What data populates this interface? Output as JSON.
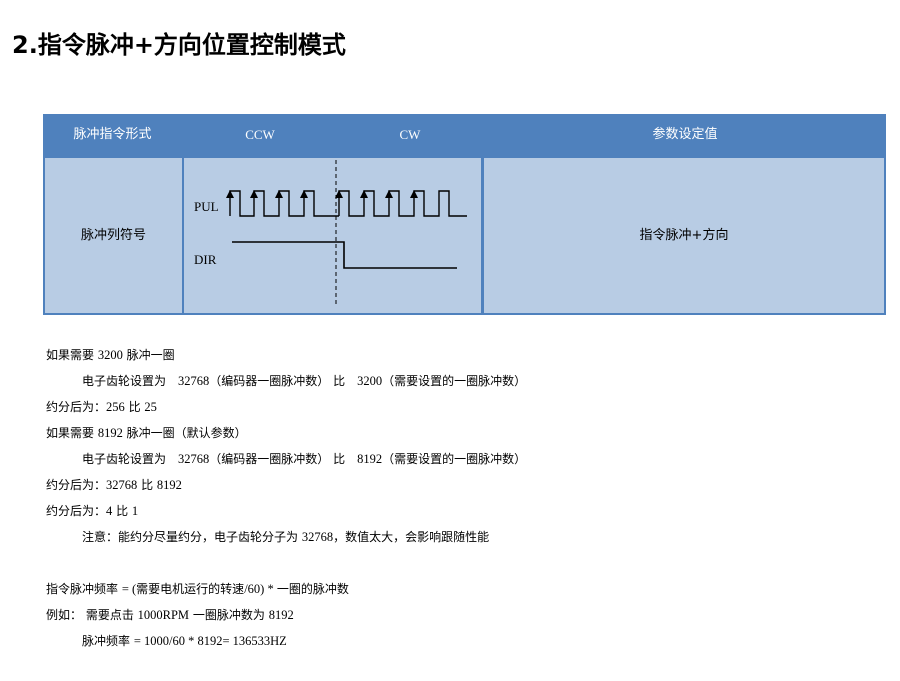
{
  "title": "2.指令脉冲+方向位置控制模式",
  "table": {
    "headers": {
      "format": "脉冲指令形式",
      "ccw": "CCW",
      "cw": "CW",
      "setting": "参数设定值"
    },
    "row": {
      "label": "脉冲列符号",
      "pul_label": "PUL",
      "dir_label": "DIR",
      "setting_value": "指令脉冲+方向"
    }
  },
  "notes": {
    "l1_a": "如果需要 ",
    "l1_n": "3200",
    "l1_b": " 脉冲一圈",
    "l2_a": "电子齿轮设置为　",
    "l2_n1": "32768",
    "l2_b": "（编码器一圈脉冲数）  比　",
    "l2_n2": "3200",
    "l2_c": "（需要设置的一圈脉冲数）",
    "l3_a": "约分后为：",
    "l3_n1": "256",
    "l3_b": " 比 ",
    "l3_n2": "25",
    "l4_a": "如果需要 ",
    "l4_n": "8192",
    "l4_b": " 脉冲一圈（默认参数）",
    "l5_a": "电子齿轮设置为　",
    "l5_n1": "32768",
    "l5_b": "（编码器一圈脉冲数）  比　",
    "l5_n2": "8192",
    "l5_c": "（需要设置的一圈脉冲数）",
    "l6_a": "约分后为：",
    "l6_n1": "32768",
    "l6_b": " 比 ",
    "l6_n2": "8192",
    "l7_a": "约分后为：",
    "l7_n1": "4",
    "l7_b": " 比 ",
    "l7_n2": "1",
    "l8_a": "注意：能约分尽量约分，电子齿轮分子为 ",
    "l8_n": "32768",
    "l8_b": "，数值太大，会影响跟随性能",
    "l9_a": "指令脉冲频率 ",
    "l9_n1": "= (",
    "l9_b": "需要电机运行的转速",
    "l9_n2": "/60) * ",
    "l9_c": "一圈的脉冲数",
    "l10_a": "例如：  需要点击 ",
    "l10_n1": "1000RPM",
    "l10_b": " 一圈脉冲数为 ",
    "l10_n2": "8192",
    "l11_a": "脉冲频率  ",
    "l11_n": "= 1000/60 * 8192= 136533HZ"
  }
}
